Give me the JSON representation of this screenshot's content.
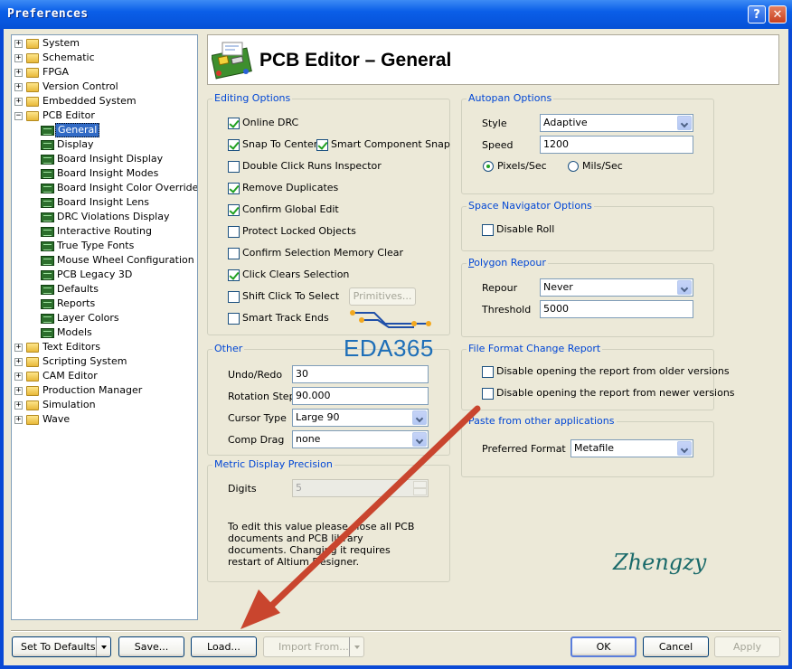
{
  "window": {
    "title": "Preferences",
    "help_label": "?",
    "close_label": "✕"
  },
  "tree": {
    "items": [
      {
        "label": "System",
        "level": 0,
        "expander": "+",
        "icon": "folder-icon"
      },
      {
        "label": "Schematic",
        "level": 0,
        "expander": "+",
        "icon": "folder-icon"
      },
      {
        "label": "FPGA",
        "level": 0,
        "expander": "+",
        "icon": "folder-icon"
      },
      {
        "label": "Version Control",
        "level": 0,
        "expander": "+",
        "icon": "folder-icon"
      },
      {
        "label": "Embedded System",
        "level": 0,
        "expander": "+",
        "icon": "folder-icon"
      },
      {
        "label": "PCB Editor",
        "level": 0,
        "expander": "−",
        "icon": "folder-open-icon"
      },
      {
        "label": "General",
        "level": 1,
        "icon": "pcb-page-icon",
        "selected": true
      },
      {
        "label": "Display",
        "level": 1,
        "icon": "pcb-page-icon"
      },
      {
        "label": "Board Insight Display",
        "level": 1,
        "icon": "pcb-page-icon"
      },
      {
        "label": "Board Insight Modes",
        "level": 1,
        "icon": "pcb-page-icon"
      },
      {
        "label": "Board Insight Color Overrides",
        "level": 1,
        "icon": "pcb-page-icon"
      },
      {
        "label": "Board Insight Lens",
        "level": 1,
        "icon": "pcb-page-icon"
      },
      {
        "label": "DRC Violations Display",
        "level": 1,
        "icon": "pcb-page-icon"
      },
      {
        "label": "Interactive Routing",
        "level": 1,
        "icon": "pcb-page-icon"
      },
      {
        "label": "True Type Fonts",
        "level": 1,
        "icon": "pcb-page-icon"
      },
      {
        "label": "Mouse Wheel Configuration",
        "level": 1,
        "icon": "pcb-page-icon"
      },
      {
        "label": "PCB Legacy 3D",
        "level": 1,
        "icon": "pcb-3d-icon"
      },
      {
        "label": "Defaults",
        "level": 1,
        "icon": "pcb-page-icon"
      },
      {
        "label": "Reports",
        "level": 1,
        "icon": "report-icon"
      },
      {
        "label": "Layer Colors",
        "level": 1,
        "icon": "pcb-page-icon"
      },
      {
        "label": "Models",
        "level": 1,
        "icon": "pcb-page-icon"
      },
      {
        "label": "Text Editors",
        "level": 0,
        "expander": "+",
        "icon": "folder-icon"
      },
      {
        "label": "Scripting System",
        "level": 0,
        "expander": "+",
        "icon": "folder-icon"
      },
      {
        "label": "CAM Editor",
        "level": 0,
        "expander": "+",
        "icon": "folder-icon"
      },
      {
        "label": "Production Manager",
        "level": 0,
        "expander": "+",
        "icon": "folder-icon"
      },
      {
        "label": "Simulation",
        "level": 0,
        "expander": "+",
        "icon": "folder-icon"
      },
      {
        "label": "Wave",
        "level": 0,
        "expander": "+",
        "icon": "folder-icon"
      }
    ]
  },
  "header": {
    "title": "PCB Editor – General",
    "icon": "pcb-board-icon"
  },
  "editing": {
    "title": "Editing Options",
    "online_drc": "Online DRC",
    "snap_to_center": "Snap To Center",
    "smart_component_snap": "Smart Component Snap",
    "double_click_runs_inspector": "Double Click Runs Inspector",
    "remove_duplicates": "Remove Duplicates",
    "confirm_global_edit": "Confirm Global Edit",
    "protect_locked_objects": "Protect Locked Objects",
    "confirm_selection_memory_clear": "Confirm Selection Memory Clear",
    "click_clears_selection": "Click Clears Selection",
    "shift_click_to_select": "Shift Click To Select",
    "primitives_button": "Primitives...",
    "smart_track_ends": "Smart Track Ends"
  },
  "other": {
    "title": "Other",
    "undo_redo_label": "Undo/Redo",
    "undo_redo_value": "30",
    "rotation_step_label": "Rotation Step",
    "rotation_step_value": "90.000",
    "cursor_type_label": "Cursor Type",
    "cursor_type_value": "Large 90",
    "comp_drag_label": "Comp Drag",
    "comp_drag_value": "none"
  },
  "metric": {
    "title": "Metric Display Precision",
    "digits_label": "Digits",
    "digits_value": "5",
    "note": "To edit this value please close all PCB documents and PCB library documents. Changing it requires restart of Altium Designer."
  },
  "autopan": {
    "title": "Autopan Options",
    "style_label": "Style",
    "style_value": "Adaptive",
    "speed_label": "Speed",
    "speed_value": "1200",
    "pixels_label": "Pixels/Sec",
    "mils_label": "Mils/Sec"
  },
  "space_nav": {
    "title": "Space Navigator Options",
    "disable_roll": "Disable Roll"
  },
  "polygon": {
    "title": "Polygon Repour",
    "repour_label": "Repour",
    "repour_value": "Never",
    "threshold_label": "Threshold",
    "threshold_value": "5000"
  },
  "file_format": {
    "title": "File Format Change Report",
    "disable_older": "Disable opening the report from older versions",
    "disable_newer": "Disable opening the report from newer versions"
  },
  "paste": {
    "title": "Paste from other applications",
    "preferred_label": "Preferred Format",
    "preferred_value": "Metafile"
  },
  "watermarks": {
    "eda": "EDA365",
    "author": "Zhengzy"
  },
  "footer": {
    "set_to_defaults": "Set To Defaults",
    "save": "Save...",
    "load": "Load...",
    "import_from": "Import From...",
    "ok": "OK",
    "cancel": "Cancel",
    "apply": "Apply"
  },
  "colors": {
    "group_title": "#0046d5",
    "arrow": "#c9452e",
    "titlebar": "#0a5ee8"
  }
}
